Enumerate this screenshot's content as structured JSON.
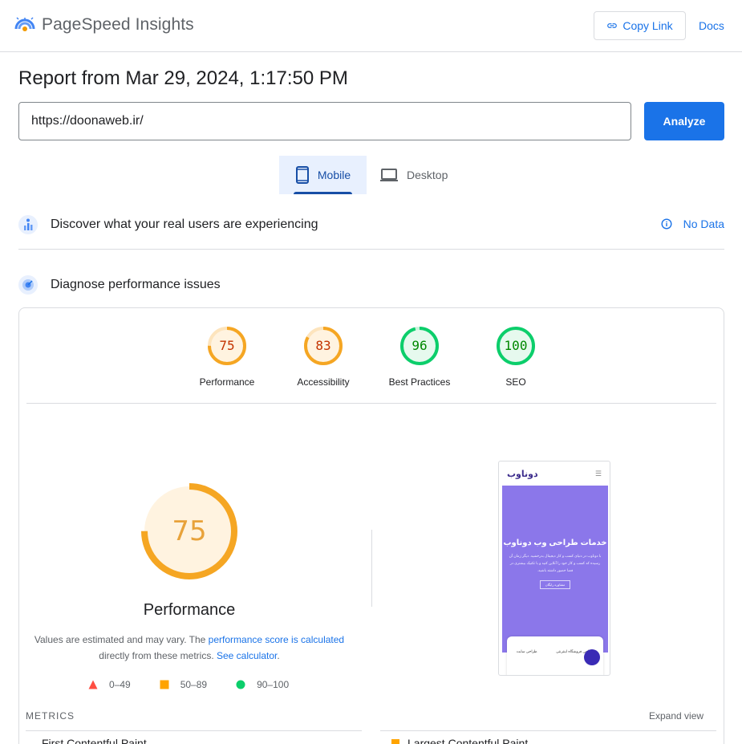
{
  "header": {
    "brand": "PageSpeed Insights",
    "copy_link": "Copy Link",
    "docs": "Docs"
  },
  "report": {
    "title": "Report from Mar 29, 2024, 1:17:50 PM"
  },
  "search": {
    "url": "https://doonaweb.ir/",
    "analyze": "Analyze"
  },
  "tabs": {
    "mobile": "Mobile",
    "desktop": "Desktop"
  },
  "field_section": {
    "title": "Discover what your real users are experiencing",
    "status": "No Data"
  },
  "lab_section": {
    "title": "Diagnose performance issues"
  },
  "scores": [
    {
      "label": "Performance",
      "value": "75",
      "color": "#e8a23a"
    },
    {
      "label": "Accessibility",
      "value": "83",
      "color": "#e8a23a"
    },
    {
      "label": "Best Practices",
      "value": "96",
      "color": "#0cce6b"
    },
    {
      "label": "SEO",
      "value": "100",
      "color": "#0cce6b"
    }
  ],
  "performance": {
    "score": "75",
    "title": "Performance",
    "note_prefix": "Values are estimated and may vary. The ",
    "note_link1": "performance score is calculated",
    "note_mid": " directly from these metrics. ",
    "note_link2": "See calculator",
    "note_end": "."
  },
  "legend": {
    "fail": "0–49",
    "average": "50–89",
    "pass": "90–100"
  },
  "screenshot": {
    "logo": "دوناوب",
    "heading": "خدمات طراحی وب دوناوب",
    "paragraph": "با دوناوب در دنیای کسب و کار دیجیتال بدرخشید. دیگر زمان آن رسیده که کسب و کار خود را آنلاین کنید و با تکنیک بیشتری در فضا حضور داشته باشید.",
    "button": "مشاوره رایگان",
    "card_item1": "طراحی سایت",
    "card_item2": "طراحی فروشگاه اینترنتی"
  },
  "metrics": {
    "label": "METRICS",
    "expand": "Expand view",
    "first": "First Contentful Paint",
    "second": "Largest Contentful Paint"
  },
  "colors": {
    "accent": "#1a73e8",
    "average": "#ffa400",
    "pass": "#0cce6b",
    "fail": "#ff4e42"
  }
}
